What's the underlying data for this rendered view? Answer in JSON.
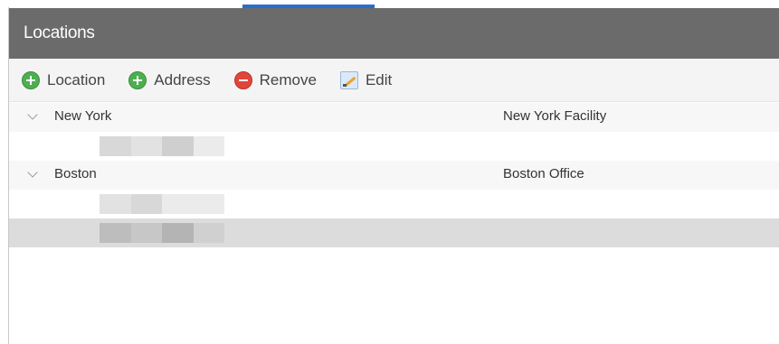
{
  "panel": {
    "title": "Locations"
  },
  "toolbar": {
    "location_label": "Location",
    "address_label": "Address",
    "remove_label": "Remove",
    "edit_label": "Edit"
  },
  "colors": {
    "header_bg": "#6b6b6b",
    "add_icon": "#4caf50",
    "remove_icon": "#e0453b",
    "selection": "#dcdcdc"
  },
  "tree": {
    "groups": [
      {
        "name": "New York",
        "description": "New York Facility",
        "expanded": true,
        "child_count": 1
      },
      {
        "name": "Boston",
        "description": "Boston Office",
        "expanded": true,
        "child_count": 2
      }
    ]
  }
}
